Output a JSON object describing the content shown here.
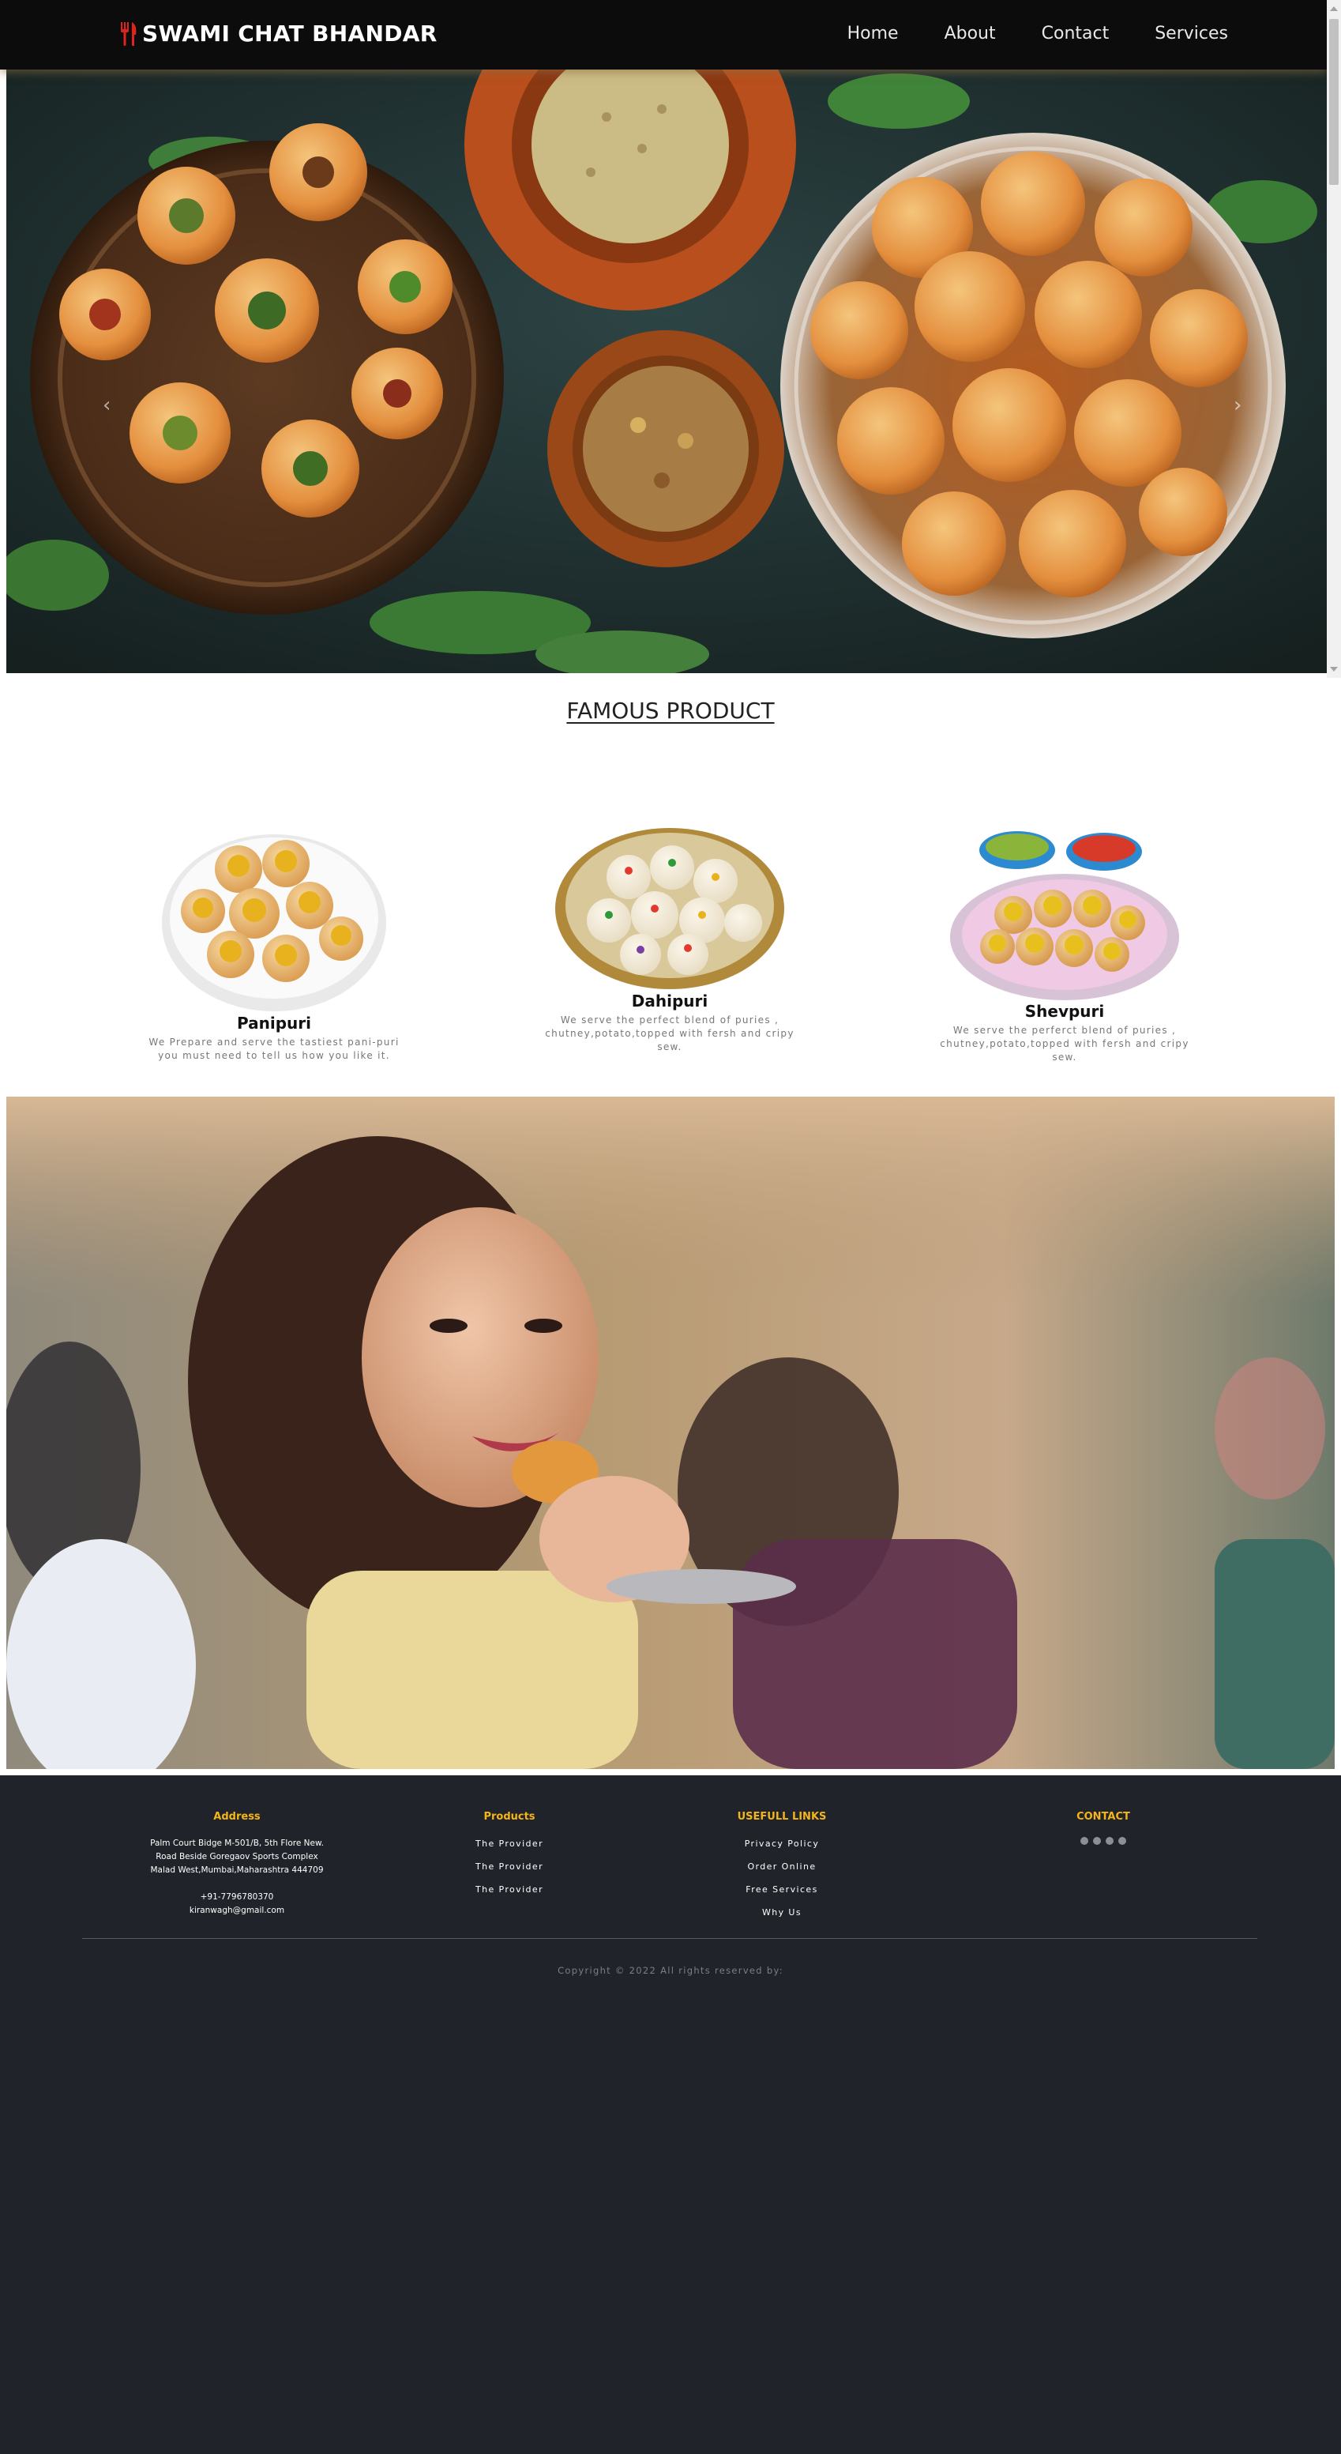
{
  "brand": {
    "name": "SWAMI CHAT BHANDAR",
    "icon": "fork-knife-icon",
    "icon_color": "#e0231f"
  },
  "nav": {
    "links": [
      "Home",
      "About",
      "Contact",
      "Services"
    ]
  },
  "hero": {
    "prev_icon": "‹",
    "next_icon": "›"
  },
  "section": {
    "title": "FAMOUS PRODUCT"
  },
  "products": [
    {
      "name": "Panipuri",
      "desc": "We Prepare and serve the tastiest pani-puri you must need to tell us how you like it."
    },
    {
      "name": "Dahipuri",
      "desc": "We serve the perfect blend of puries , chutney,potato,topped with fersh and cripy sew."
    },
    {
      "name": "Shevpuri",
      "desc": "We serve the perferct blend of puries , chutney,potato,topped with fersh and cripy sew."
    }
  ],
  "footer": {
    "address": {
      "heading": "Address",
      "lines": [
        "Palm Court Bidge M-501/B, 5th Flore New.",
        "Road Beside Goregaov Sports Complex",
        "Malad West,Mumbai,Maharashtra 444709"
      ],
      "phone": "+91-7796780370",
      "email": "kiranwagh@gmail.com"
    },
    "products": {
      "heading": "Products",
      "links": [
        "The Provider",
        "The Provider",
        "The Provider"
      ]
    },
    "useful": {
      "heading": "USEFULL LINKS",
      "links": [
        "Privacy Policy",
        "Order Online",
        "Free Services",
        "Why Us"
      ]
    },
    "contact": {
      "heading": "CONTACT",
      "icons": [
        "instagram-icon",
        "facebook-icon",
        "google-icon",
        "github-icon"
      ]
    },
    "copyright": "Copyright © 2022 All rights reserved by:"
  },
  "colors": {
    "navbar": "#0c0c0c",
    "footer": "#202329",
    "accent": "#f5b518"
  }
}
